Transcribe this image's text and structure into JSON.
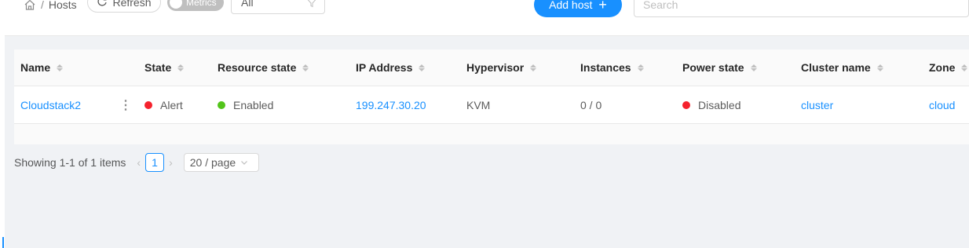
{
  "header": {
    "breadcrumb": {
      "home_icon": "home-icon",
      "separator": "/",
      "current": "Hosts"
    },
    "refresh_label": "Refresh",
    "metrics_toggle_label": "Metrics",
    "filter_select_value": "All",
    "add_host_label": "Add host",
    "search_placeholder": "Search"
  },
  "table": {
    "columns": [
      "Name",
      "State",
      "Resource state",
      "IP Address",
      "Hypervisor",
      "Instances",
      "Power state",
      "Cluster name",
      "Zone"
    ],
    "rows": [
      {
        "name": "Cloudstack2",
        "state": "Alert",
        "resource_state": "Enabled",
        "ip_address": "199.247.30.20",
        "hypervisor": "KVM",
        "instances": "0 / 0",
        "power_state": "Disabled",
        "cluster_name": "cluster",
        "zone": "cloud"
      }
    ]
  },
  "pagination": {
    "summary": "Showing 1-1 of 1 items",
    "current_page": "1",
    "page_size": "20 / page"
  },
  "colors": {
    "accent": "#1890ff",
    "alert_red": "#f5222d",
    "enabled_green": "#52c41a"
  }
}
